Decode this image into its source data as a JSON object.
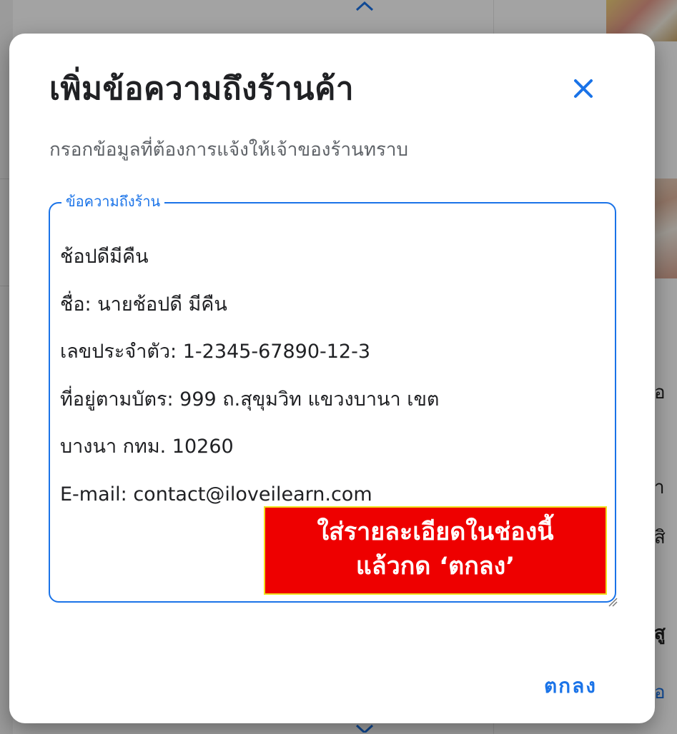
{
  "dialog": {
    "title": "เพิ่มข้อความถึงร้านค้า",
    "subtitle": "กรอกข้อมูลที่ต้องการแจ้งให้เจ้าของร้านทราบ",
    "close_icon": "close-icon",
    "field": {
      "label": "ข้อความถึงร้าน",
      "lines": [
        "ช้อปดีมีคืน",
        "ชื่อ: นายช้อปดี มีคืน",
        "เลขประจำตัว: 1-2345-67890-12-3",
        "ที่อยู่ตามบัตร: 999 ถ.สุขุมวิท แขวงบานา เขต",
        "บางนา กทม. 10260",
        "E-mail: contact@iloveilearn.com"
      ]
    },
    "callout": {
      "line1": "ใส่รายละเอียดในช่องนี้",
      "line2": "แล้วกด ‘ตกลง’"
    },
    "ok_label": "ตกลง"
  },
  "background": {
    "peek_1": "อ",
    "peek_2": "า",
    "peek_3": "สิ",
    "peek_4": "สู",
    "peek_5": "อ"
  },
  "colors": {
    "accent": "#1a73e8",
    "callout_bg": "#ee0000",
    "callout_border": "#f0e020"
  }
}
